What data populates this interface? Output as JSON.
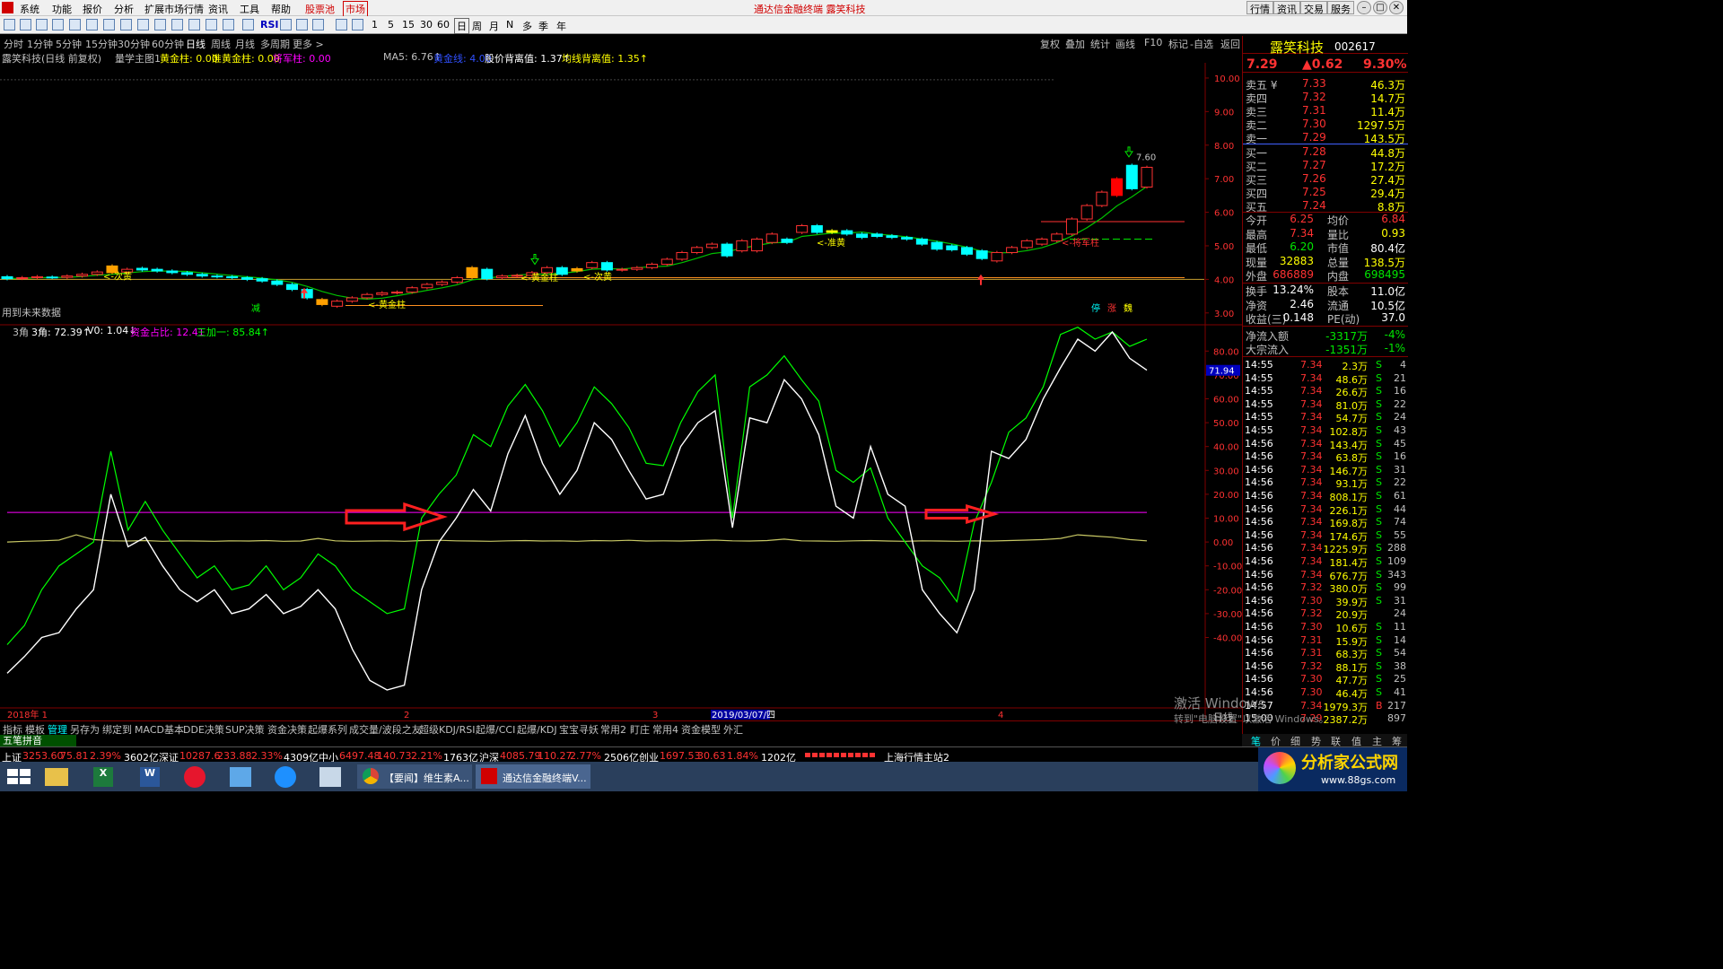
{
  "app": {
    "title": "通达信金融终端  露笑科技",
    "menu": [
      "系统",
      "功能",
      "报价",
      "分析",
      "扩展市场行情",
      "资讯",
      "工具",
      "帮助",
      "股票池",
      "市场"
    ],
    "right_buttons": [
      "行情",
      "资讯",
      "交易",
      "服务"
    ],
    "window_controls": [
      "–",
      "□",
      "✕"
    ]
  },
  "toolbar": {
    "labels": [
      "RSI",
      "1",
      "5",
      "15",
      "30",
      "60",
      "日",
      "周",
      "月",
      "N",
      "多",
      "季",
      "年"
    ]
  },
  "periods": {
    "items": [
      "分时",
      "1分钟",
      "5分钟",
      "15分钟",
      "30分钟",
      "60分钟",
      "日线",
      "周线",
      "月线",
      "多周期",
      "更多 >"
    ],
    "active": "日线",
    "right_items": [
      "复权",
      "叠加",
      "统计",
      "画线",
      "F10",
      "标记",
      "-自选",
      "返回"
    ]
  },
  "main_header": {
    "stock": "露笑科技(日线 前复权)",
    "formula": "量学主图1",
    "items": [
      {
        "label": "黄金柱: 0.00",
        "color": "#ffff00"
      },
      {
        "label": "准黄金柱: 0.00",
        "color": "#ffff00"
      },
      {
        "label": "将军柱: 0.00",
        "color": "#ff00ff"
      },
      {
        "label": "MA5: 6.76↑",
        "color": "#c0c0c0"
      },
      {
        "label": "黄金线: 4.00",
        "color": "#0000ff"
      },
      {
        "label": "股价背离值: 1.37↑",
        "color": "#ffffff"
      },
      {
        "label": "均线背离值: 1.35↑",
        "color": "#ffff00"
      }
    ],
    "note": "用到未来数据"
  },
  "chart_annotations": {
    "labels": [
      {
        "text": "<-次黄",
        "color": "#ffff00"
      },
      {
        "text": "<-黄金柱",
        "color": "#ffff00"
      },
      {
        "text": "<-黄金柱",
        "color": "#ffff00"
      },
      {
        "text": "<-次黄",
        "color": "#ffff00"
      },
      {
        "text": "<-准黄",
        "color": "#ffff00"
      },
      {
        "text": "<-将军柱",
        "color": "#ff3232"
      },
      {
        "text": "7.60",
        "color": "#c0c0c0"
      },
      {
        "text": "减",
        "color": "#00ff00"
      },
      {
        "text": "停",
        "color": "#00ffff"
      },
      {
        "text": "涨",
        "color": "#ff3232"
      },
      {
        "text": "魏",
        "color": "#ffff00"
      }
    ]
  },
  "chart_data": [
    {
      "type": "candlestick",
      "yticks": [
        "10.00",
        "9.00",
        "8.00",
        "7.00",
        "6.00",
        "5.00",
        "4.00",
        "3.00"
      ],
      "ylim": [
        2.7,
        10.4
      ],
      "bars": [
        {
          "o": 4.08,
          "c": 4.02
        },
        {
          "o": 4.03,
          "c": 4.05
        },
        {
          "o": 4.05,
          "c": 4.08
        },
        {
          "o": 4.07,
          "c": 4.06
        },
        {
          "o": 4.06,
          "c": 4.1
        },
        {
          "o": 4.1,
          "c": 4.15
        },
        {
          "o": 4.15,
          "c": 4.22
        },
        {
          "o": 4.4,
          "c": 4.2
        },
        {
          "o": 4.22,
          "c": 4.3
        },
        {
          "o": 4.33,
          "c": 4.28
        },
        {
          "o": 4.3,
          "c": 4.25
        },
        {
          "o": 4.25,
          "c": 4.2
        },
        {
          "o": 4.2,
          "c": 4.15
        },
        {
          "o": 4.15,
          "c": 4.1
        },
        {
          "o": 4.1,
          "c": 4.08
        },
        {
          "o": 4.08,
          "c": 4.05
        },
        {
          "o": 4.05,
          "c": 4.0
        },
        {
          "o": 4.02,
          "c": 3.95
        },
        {
          "o": 3.95,
          "c": 3.85
        },
        {
          "o": 3.85,
          "c": 3.7
        },
        {
          "o": 3.7,
          "c": 3.45
        },
        {
          "o": 3.4,
          "c": 3.25
        },
        {
          "o": 3.2,
          "c": 3.35
        },
        {
          "o": 3.35,
          "c": 3.45
        },
        {
          "o": 3.45,
          "c": 3.55
        },
        {
          "o": 3.55,
          "c": 3.6
        },
        {
          "o": 3.6,
          "c": 3.62
        },
        {
          "o": 3.62,
          "c": 3.75
        },
        {
          "o": 3.75,
          "c": 3.85
        },
        {
          "o": 3.85,
          "c": 3.92
        },
        {
          "o": 3.92,
          "c": 4.05
        },
        {
          "o": 4.05,
          "c": 4.35
        },
        {
          "o": 4.3,
          "c": 4.02
        },
        {
          "o": 4.05,
          "c": 4.1
        },
        {
          "o": 4.1,
          "c": 4.12
        },
        {
          "o": 4.12,
          "c": 4.2
        },
        {
          "o": 4.2,
          "c": 4.35
        },
        {
          "o": 4.35,
          "c": 4.15
        },
        {
          "o": 4.25,
          "c": 4.32
        },
        {
          "o": 4.35,
          "c": 4.5
        },
        {
          "o": 4.5,
          "c": 4.28
        },
        {
          "o": 4.28,
          "c": 4.3
        },
        {
          "o": 4.3,
          "c": 4.35
        },
        {
          "o": 4.35,
          "c": 4.45
        },
        {
          "o": 4.45,
          "c": 4.6
        },
        {
          "o": 4.6,
          "c": 4.8
        },
        {
          "o": 4.8,
          "c": 4.95
        },
        {
          "o": 4.95,
          "c": 5.05
        },
        {
          "o": 5.05,
          "c": 4.7
        },
        {
          "o": 4.85,
          "c": 5.15
        },
        {
          "o": 4.85,
          "c": 5.2
        },
        {
          "o": 5.1,
          "c": 5.35
        },
        {
          "o": 5.2,
          "c": 5.1
        },
        {
          "o": 5.4,
          "c": 5.6
        },
        {
          "o": 5.6,
          "c": 5.4
        },
        {
          "o": 5.4,
          "c": 5.45
        },
        {
          "o": 5.45,
          "c": 5.35
        },
        {
          "o": 5.35,
          "c": 5.25
        },
        {
          "o": 5.35,
          "c": 5.28
        },
        {
          "o": 5.3,
          "c": 5.25
        },
        {
          "o": 5.25,
          "c": 5.2
        },
        {
          "o": 5.2,
          "c": 5.05
        },
        {
          "o": 5.1,
          "c": 4.9
        },
        {
          "o": 5.0,
          "c": 4.88
        },
        {
          "o": 4.95,
          "c": 4.75
        },
        {
          "o": 4.85,
          "c": 4.62
        },
        {
          "o": 4.55,
          "c": 4.8
        },
        {
          "o": 4.8,
          "c": 4.95
        },
        {
          "o": 4.95,
          "c": 5.15
        },
        {
          "o": 5.05,
          "c": 5.2
        },
        {
          "o": 5.15,
          "c": 5.35
        },
        {
          "o": 5.35,
          "c": 5.8
        },
        {
          "o": 5.8,
          "c": 6.2
        },
        {
          "o": 6.2,
          "c": 6.6
        },
        {
          "o": 6.5,
          "c": 7.0
        },
        {
          "o": 7.4,
          "c": 6.7
        },
        {
          "o": 6.75,
          "c": 7.34
        }
      ],
      "reference_lines": [
        "4.00",
        "4.45",
        "5.20",
        "5.70"
      ]
    },
    {
      "type": "line",
      "title": "3角",
      "header": [
        {
          "label": "3角: 72.39↑",
          "color": "#ffffff"
        },
        {
          "label": "V0: 1.04↓",
          "color": "#ffffff"
        },
        {
          "label": "资金占比: 12.41",
          "color": "#ff00ff"
        },
        {
          "label": "三加一: 85.84↑",
          "color": "#00ff00"
        }
      ],
      "yticks": [
        "80.00",
        "70.00",
        "60.00",
        "50.00",
        "40.00",
        "30.00",
        "20.00",
        "10.00",
        "0.00",
        "-10.00",
        "-20.00",
        "-30.00",
        "-40.00"
      ],
      "ylim": [
        -68,
        88
      ],
      "current_value": "71.94",
      "series": [
        {
          "name": "3角",
          "color": "#ffffff",
          "values": [
            -55,
            -48,
            -40,
            -38,
            -28,
            -20,
            20,
            -2,
            2,
            -10,
            -20,
            -25,
            -20,
            -30,
            -28,
            -22,
            -30,
            -27,
            -20,
            -28,
            -45,
            -58,
            -62,
            -60,
            -20,
            0,
            10,
            22,
            13,
            37,
            53,
            33,
            20,
            30,
            50,
            43,
            30,
            18,
            20,
            40,
            50,
            55,
            6,
            52,
            50,
            68,
            60,
            45,
            15,
            10,
            40,
            20,
            15,
            -20,
            -30,
            -38,
            -20,
            38,
            35,
            43,
            60,
            73,
            85,
            80,
            88,
            77,
            72
          ]
        },
        {
          "name": "三加一",
          "color": "#00ff00",
          "values": [
            -43,
            -35,
            -20,
            -10,
            -5,
            0,
            38,
            5,
            17,
            5,
            -5,
            -15,
            -10,
            -20,
            -18,
            -10,
            -20,
            -15,
            -5,
            -10,
            -20,
            -25,
            -30,
            -28,
            10,
            20,
            28,
            45,
            40,
            57,
            66,
            55,
            40,
            50,
            65,
            58,
            48,
            33,
            32,
            50,
            63,
            70,
            10,
            65,
            70,
            78,
            68,
            59,
            30,
            25,
            31,
            10,
            0,
            -10,
            -15,
            -25,
            8,
            25,
            46,
            52,
            65,
            87,
            90,
            85,
            88,
            82,
            85
          ]
        },
        {
          "name": "资金占比",
          "color": "#ff00ff",
          "values": [
            12.4,
            12.4
          ]
        },
        {
          "name": "V0",
          "color": "#c8c864",
          "values": [
            0,
            0.3,
            0.5,
            0.8,
            3,
            1,
            0.5,
            0.4,
            0.6,
            0.3,
            0.5,
            0.4,
            0.3,
            0.5,
            0.4,
            0.6,
            0.3,
            0.4,
            1.5,
            0.5,
            0.3,
            0.4,
            0.5,
            0.3,
            0.6,
            0.7,
            0.5,
            0.4,
            0.3,
            0.5,
            0.6,
            0.4,
            0.5,
            0.3,
            0.6,
            0.5,
            0.7,
            0.4,
            0.5,
            0.4,
            0.6,
            0.8,
            0.5,
            0.4,
            0.6,
            1.2,
            0.5,
            0.4,
            0.3,
            0.5,
            0.6,
            0.4,
            0.3,
            0.5,
            0.4,
            0.3,
            0.5,
            0.4,
            0.6,
            0.8,
            1.0,
            1.5,
            3,
            2.5,
            2,
            1,
            0.5
          ]
        }
      ]
    }
  ],
  "x_axis": {
    "labels": [
      "2018年 1",
      "2",
      "2019/03/07/四",
      "3",
      "4"
    ]
  },
  "bottom_tabs": {
    "items": [
      "指标",
      "模板",
      "管理",
      "另存为",
      "绑定到",
      "MACD基本",
      "DDE决策",
      "SUP决策",
      "资金决策",
      "起爆系列",
      "成交量/波段之友",
      "超级KDJ/RSI",
      "起爆/CCI",
      "起爆/KDJ",
      "宝宝寻妖",
      "常用2",
      "盯庄",
      "常用4",
      "资金模型",
      "外汇"
    ],
    "active": "管理"
  },
  "pinyin_label": "五笔拼音",
  "index_bar": [
    {
      "label": "上证",
      "value": "3253.60",
      "chg": "75.81",
      "pct": "2.39%",
      "amt": "3602亿"
    },
    {
      "label": "深证",
      "value": "10287.6",
      "chg": "233.88",
      "pct": "2.33%",
      "amt": "4309亿"
    },
    {
      "label": "中小",
      "value": "6497.48",
      "chg": "140.73",
      "pct": "2.21%",
      "amt": "1763亿"
    },
    {
      "label": "沪深",
      "value": "4085.79",
      "chg": "110.27",
      "pct": "2.77%",
      "amt": "2506亿"
    },
    {
      "label": "创业",
      "value": "1697.53",
      "chg": "30.63",
      "pct": "1.84%",
      "amt": "1202亿"
    }
  ],
  "station": "上海行情主站2",
  "quote": {
    "name": "露笑科技",
    "code": "002617",
    "price": "7.29",
    "change": "▲0.62",
    "pct": "9.30%",
    "asks": [
      {
        "label": "卖五 ¥",
        "price": "7.33",
        "vol": "46.3万"
      },
      {
        "label": "卖四",
        "price": "7.32",
        "vol": "14.7万"
      },
      {
        "label": "卖三",
        "price": "7.31",
        "vol": "11.4万"
      },
      {
        "label": "卖二",
        "price": "7.30",
        "vol": "1297.5万"
      },
      {
        "label": "卖一",
        "price": "7.29",
        "vol": "143.5万"
      }
    ],
    "bids": [
      {
        "label": "买一",
        "price": "7.28",
        "vol": "44.8万"
      },
      {
        "label": "买二",
        "price": "7.27",
        "vol": "17.2万"
      },
      {
        "label": "买三",
        "price": "7.26",
        "vol": "27.4万"
      },
      {
        "label": "买四",
        "price": "7.25",
        "vol": "29.4万"
      },
      {
        "label": "买五",
        "price": "7.24",
        "vol": "8.8万"
      }
    ],
    "stats": [
      {
        "l1": "今开",
        "v1": "6.25",
        "c1": "#ff3232",
        "l2": "均价",
        "v2": "6.84",
        "c2": "#ff3232"
      },
      {
        "l1": "最高",
        "v1": "7.34",
        "c1": "#ff3232",
        "l2": "量比",
        "v2": "0.93",
        "c2": "#ffff00"
      },
      {
        "l1": "最低",
        "v1": "6.20",
        "c1": "#00e600",
        "l2": "市值",
        "v2": "80.4亿",
        "c2": "#ffffff"
      },
      {
        "l1": "现量",
        "v1": "32883",
        "c1": "#ffff00",
        "l2": "总量",
        "v2": "138.5万",
        "c2": "#ffff00"
      },
      {
        "l1": "外盘",
        "v1": "686889",
        "c1": "#ff3232",
        "l2": "内盘",
        "v2": "698495",
        "c2": "#00e600"
      }
    ],
    "stats2": [
      {
        "l1": "换手",
        "v1": "13.24%",
        "c1": "#ffffff",
        "l2": "股本",
        "v2": "11.0亿",
        "c2": "#ffffff"
      },
      {
        "l1": "净资",
        "v1": "2.46",
        "c1": "#ffffff",
        "l2": "流通",
        "v2": "10.5亿",
        "c2": "#ffffff"
      },
      {
        "l1": "收益(三)",
        "v1": "0.148",
        "c1": "#ffffff",
        "l2": "PE(动)",
        "v2": "37.0",
        "c2": "#ffffff"
      }
    ],
    "flow": [
      {
        "label": "净流入额",
        "value": "-3317万",
        "pct": "-4%"
      },
      {
        "label": "大宗流入",
        "value": "-1351万",
        "pct": "-1%"
      }
    ],
    "ticks": [
      {
        "t": "14:55",
        "p": "7.34",
        "v": "2.3万",
        "s": "S",
        "n": "4"
      },
      {
        "t": "14:55",
        "p": "7.34",
        "v": "48.6万",
        "s": "S",
        "n": "21"
      },
      {
        "t": "14:55",
        "p": "7.34",
        "v": "26.6万",
        "s": "S",
        "n": "16"
      },
      {
        "t": "14:55",
        "p": "7.34",
        "v": "81.0万",
        "s": "S",
        "n": "22"
      },
      {
        "t": "14:55",
        "p": "7.34",
        "v": "54.7万",
        "s": "S",
        "n": "24"
      },
      {
        "t": "14:55",
        "p": "7.34",
        "v": "102.8万",
        "s": "S",
        "n": "43"
      },
      {
        "t": "14:56",
        "p": "7.34",
        "v": "143.4万",
        "s": "S",
        "n": "45"
      },
      {
        "t": "14:56",
        "p": "7.34",
        "v": "63.8万",
        "s": "S",
        "n": "16"
      },
      {
        "t": "14:56",
        "p": "7.34",
        "v": "146.7万",
        "s": "S",
        "n": "31"
      },
      {
        "t": "14:56",
        "p": "7.34",
        "v": "93.1万",
        "s": "S",
        "n": "22"
      },
      {
        "t": "14:56",
        "p": "7.34",
        "v": "808.1万",
        "s": "S",
        "n": "61"
      },
      {
        "t": "14:56",
        "p": "7.34",
        "v": "226.1万",
        "s": "S",
        "n": "44"
      },
      {
        "t": "14:56",
        "p": "7.34",
        "v": "169.8万",
        "s": "S",
        "n": "74"
      },
      {
        "t": "14:56",
        "p": "7.34",
        "v": "174.6万",
        "s": "S",
        "n": "55"
      },
      {
        "t": "14:56",
        "p": "7.34",
        "v": "1225.9万",
        "s": "S",
        "n": "288"
      },
      {
        "t": "14:56",
        "p": "7.34",
        "v": "181.4万",
        "s": "S",
        "n": "109"
      },
      {
        "t": "14:56",
        "p": "7.34",
        "v": "676.7万",
        "s": "S",
        "n": "343"
      },
      {
        "t": "14:56",
        "p": "7.32",
        "v": "380.0万",
        "s": "S",
        "n": "99"
      },
      {
        "t": "14:56",
        "p": "7.30",
        "v": "39.9万",
        "s": "S",
        "n": "31"
      },
      {
        "t": "14:56",
        "p": "7.32",
        "v": "20.9万",
        "s": "",
        "n": "24"
      },
      {
        "t": "14:56",
        "p": "7.30",
        "v": "10.6万",
        "s": "S",
        "n": "11"
      },
      {
        "t": "14:56",
        "p": "7.31",
        "v": "15.9万",
        "s": "S",
        "n": "14"
      },
      {
        "t": "14:56",
        "p": "7.31",
        "v": "68.3万",
        "s": "S",
        "n": "54"
      },
      {
        "t": "14:56",
        "p": "7.32",
        "v": "88.1万",
        "s": "S",
        "n": "38"
      },
      {
        "t": "14:56",
        "p": "7.30",
        "v": "47.7万",
        "s": "S",
        "n": "25"
      },
      {
        "t": "14:56",
        "p": "7.30",
        "v": "46.4万",
        "s": "S",
        "n": "41"
      },
      {
        "t": "14:57",
        "p": "7.34",
        "v": "1979.3万",
        "s": "B",
        "n": "217"
      },
      {
        "t": "15:00",
        "p": "7.29",
        "v": "2387.2万",
        "s": "",
        "n": "897"
      }
    ],
    "tabs": [
      "笔",
      "价",
      "细",
      "势",
      "联",
      "值",
      "主",
      "筹"
    ]
  },
  "taskbar": {
    "items": [
      "【要闻】维生素A...",
      "通达信金融终端V..."
    ]
  },
  "watermark": {
    "line1": "激活 Windows",
    "line2": "转到\"电脑设置\"以激活 Windows。",
    "site": "分析家公式网",
    "url": "www.88gs.com",
    "side": "日线"
  }
}
